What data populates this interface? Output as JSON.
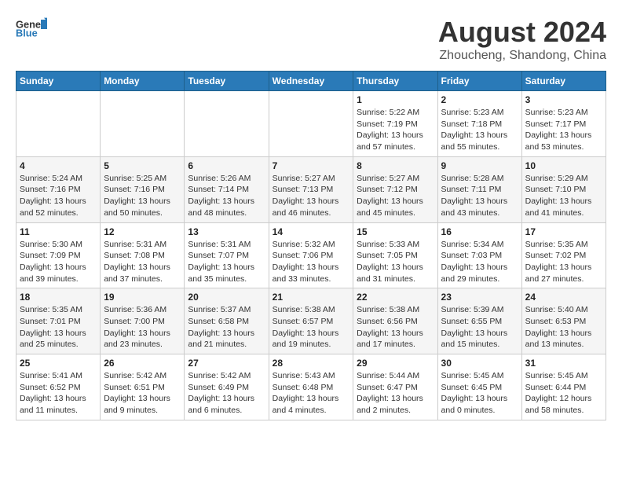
{
  "header": {
    "logo_general": "General",
    "logo_blue": "Blue",
    "month": "August 2024",
    "location": "Zhoucheng, Shandong, China"
  },
  "weekdays": [
    "Sunday",
    "Monday",
    "Tuesday",
    "Wednesday",
    "Thursday",
    "Friday",
    "Saturday"
  ],
  "weeks": [
    [
      {
        "day": "",
        "info": ""
      },
      {
        "day": "",
        "info": ""
      },
      {
        "day": "",
        "info": ""
      },
      {
        "day": "",
        "info": ""
      },
      {
        "day": "1",
        "info": "Sunrise: 5:22 AM\nSunset: 7:19 PM\nDaylight: 13 hours\nand 57 minutes."
      },
      {
        "day": "2",
        "info": "Sunrise: 5:23 AM\nSunset: 7:18 PM\nDaylight: 13 hours\nand 55 minutes."
      },
      {
        "day": "3",
        "info": "Sunrise: 5:23 AM\nSunset: 7:17 PM\nDaylight: 13 hours\nand 53 minutes."
      }
    ],
    [
      {
        "day": "4",
        "info": "Sunrise: 5:24 AM\nSunset: 7:16 PM\nDaylight: 13 hours\nand 52 minutes."
      },
      {
        "day": "5",
        "info": "Sunrise: 5:25 AM\nSunset: 7:16 PM\nDaylight: 13 hours\nand 50 minutes."
      },
      {
        "day": "6",
        "info": "Sunrise: 5:26 AM\nSunset: 7:14 PM\nDaylight: 13 hours\nand 48 minutes."
      },
      {
        "day": "7",
        "info": "Sunrise: 5:27 AM\nSunset: 7:13 PM\nDaylight: 13 hours\nand 46 minutes."
      },
      {
        "day": "8",
        "info": "Sunrise: 5:27 AM\nSunset: 7:12 PM\nDaylight: 13 hours\nand 45 minutes."
      },
      {
        "day": "9",
        "info": "Sunrise: 5:28 AM\nSunset: 7:11 PM\nDaylight: 13 hours\nand 43 minutes."
      },
      {
        "day": "10",
        "info": "Sunrise: 5:29 AM\nSunset: 7:10 PM\nDaylight: 13 hours\nand 41 minutes."
      }
    ],
    [
      {
        "day": "11",
        "info": "Sunrise: 5:30 AM\nSunset: 7:09 PM\nDaylight: 13 hours\nand 39 minutes."
      },
      {
        "day": "12",
        "info": "Sunrise: 5:31 AM\nSunset: 7:08 PM\nDaylight: 13 hours\nand 37 minutes."
      },
      {
        "day": "13",
        "info": "Sunrise: 5:31 AM\nSunset: 7:07 PM\nDaylight: 13 hours\nand 35 minutes."
      },
      {
        "day": "14",
        "info": "Sunrise: 5:32 AM\nSunset: 7:06 PM\nDaylight: 13 hours\nand 33 minutes."
      },
      {
        "day": "15",
        "info": "Sunrise: 5:33 AM\nSunset: 7:05 PM\nDaylight: 13 hours\nand 31 minutes."
      },
      {
        "day": "16",
        "info": "Sunrise: 5:34 AM\nSunset: 7:03 PM\nDaylight: 13 hours\nand 29 minutes."
      },
      {
        "day": "17",
        "info": "Sunrise: 5:35 AM\nSunset: 7:02 PM\nDaylight: 13 hours\nand 27 minutes."
      }
    ],
    [
      {
        "day": "18",
        "info": "Sunrise: 5:35 AM\nSunset: 7:01 PM\nDaylight: 13 hours\nand 25 minutes."
      },
      {
        "day": "19",
        "info": "Sunrise: 5:36 AM\nSunset: 7:00 PM\nDaylight: 13 hours\nand 23 minutes."
      },
      {
        "day": "20",
        "info": "Sunrise: 5:37 AM\nSunset: 6:58 PM\nDaylight: 13 hours\nand 21 minutes."
      },
      {
        "day": "21",
        "info": "Sunrise: 5:38 AM\nSunset: 6:57 PM\nDaylight: 13 hours\nand 19 minutes."
      },
      {
        "day": "22",
        "info": "Sunrise: 5:38 AM\nSunset: 6:56 PM\nDaylight: 13 hours\nand 17 minutes."
      },
      {
        "day": "23",
        "info": "Sunrise: 5:39 AM\nSunset: 6:55 PM\nDaylight: 13 hours\nand 15 minutes."
      },
      {
        "day": "24",
        "info": "Sunrise: 5:40 AM\nSunset: 6:53 PM\nDaylight: 13 hours\nand 13 minutes."
      }
    ],
    [
      {
        "day": "25",
        "info": "Sunrise: 5:41 AM\nSunset: 6:52 PM\nDaylight: 13 hours\nand 11 minutes."
      },
      {
        "day": "26",
        "info": "Sunrise: 5:42 AM\nSunset: 6:51 PM\nDaylight: 13 hours\nand 9 minutes."
      },
      {
        "day": "27",
        "info": "Sunrise: 5:42 AM\nSunset: 6:49 PM\nDaylight: 13 hours\nand 6 minutes."
      },
      {
        "day": "28",
        "info": "Sunrise: 5:43 AM\nSunset: 6:48 PM\nDaylight: 13 hours\nand 4 minutes."
      },
      {
        "day": "29",
        "info": "Sunrise: 5:44 AM\nSunset: 6:47 PM\nDaylight: 13 hours\nand 2 minutes."
      },
      {
        "day": "30",
        "info": "Sunrise: 5:45 AM\nSunset: 6:45 PM\nDaylight: 13 hours\nand 0 minutes."
      },
      {
        "day": "31",
        "info": "Sunrise: 5:45 AM\nSunset: 6:44 PM\nDaylight: 12 hours\nand 58 minutes."
      }
    ]
  ]
}
